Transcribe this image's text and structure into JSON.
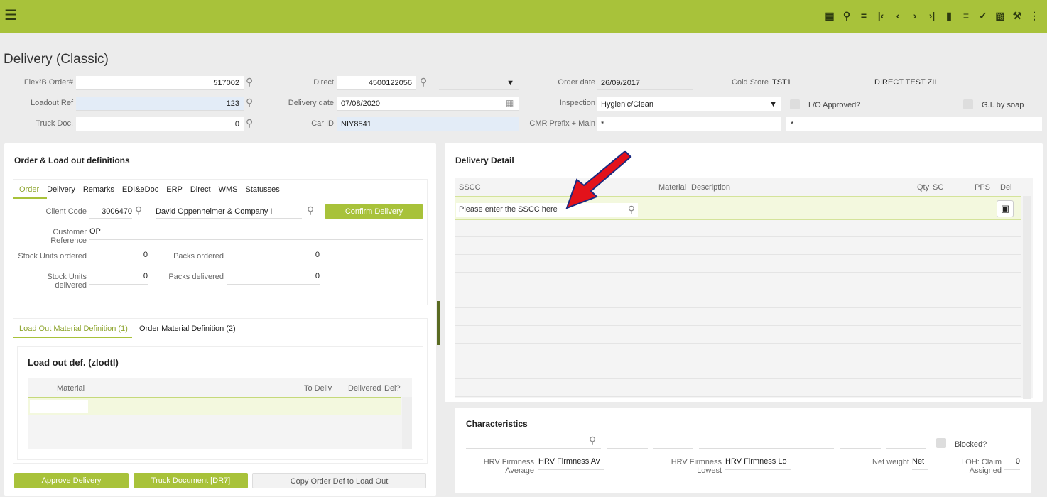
{
  "toolbar": {
    "menu_icon": "hamburger-icon",
    "icons": [
      "calendar-icon",
      "search-icon",
      "equals-icon",
      "first-icon",
      "prev-icon",
      "next-icon",
      "last-icon",
      "document-icon",
      "list-icon",
      "check-icon",
      "trash-icon",
      "wrench-icon",
      "more-icon"
    ]
  },
  "title": "Delivery (Classic)",
  "header": {
    "flex_order_label": "Flex²B Order#",
    "flex_order_value": "517002",
    "loadout_ref_label": "Loadout Ref",
    "loadout_ref_value": "123",
    "truck_doc_label": "Truck Doc.",
    "truck_doc_value": "0",
    "direct_label": "Direct",
    "direct_value": "4500122056",
    "delivery_date_label": "Delivery date",
    "delivery_date_value": "07/08/2020",
    "car_id_label": "Car ID",
    "car_id_value": "NIY8541",
    "order_date_label": "Order date",
    "order_date_value": "26/09/2017",
    "inspection_label": "Inspection",
    "inspection_value": "Hygienic/Clean",
    "cmr_label": "CMR Prefix + Main",
    "cmr_value": "*",
    "cmr_main_value": "*",
    "cold_store_label": "Cold Store",
    "cold_store_value": "TST1",
    "direct_test": "DIRECT TEST ZIL",
    "lo_approved_label": "L/O Approved?",
    "gi_soap_label": "G.I. by soap"
  },
  "order_panel": {
    "title": "Order & Load out definitions",
    "tabs": [
      "Order",
      "Delivery",
      "Remarks",
      "EDI&eDoc",
      "ERP",
      "Direct",
      "WMS",
      "Statusses"
    ],
    "client_code_label": "Client Code",
    "client_code_value": "3006470",
    "client_name": "David Oppenheimer & Company I",
    "confirm_label": "Confirm Delivery",
    "customer_ref_label_1": "Customer",
    "customer_ref_label_2": "Reference",
    "customer_ref_value": "OP",
    "stock_ordered_label": "Stock Units ordered",
    "stock_ordered_value": "0",
    "packs_ordered_label": "Packs ordered",
    "packs_ordered_value": "0",
    "stock_delivered_label_1": "Stock Units",
    "stock_delivered_label_2": "delivered",
    "stock_delivered_value": "0",
    "packs_delivered_label": "Packs delivered",
    "packs_delivered_value": "0"
  },
  "loadout_panel": {
    "tabs": [
      "Load Out Material Definition (1)",
      "Order Material Definition (2)"
    ],
    "title": "Load out def. (zlodtl)",
    "columns": [
      "Material",
      "To Deliv",
      "Delivered",
      "Del?"
    ]
  },
  "buttons": {
    "approve": "Approve Delivery",
    "truck": "Truck Document [DR7]",
    "copy": "Copy Order Def to Load Out"
  },
  "delivery_detail": {
    "title": "Delivery Detail",
    "columns": [
      "SSCC",
      "Material",
      "Description",
      "Qty",
      "SC",
      "PPS",
      "Del"
    ],
    "sscc_placeholder": "Please enter the SSCC here"
  },
  "characteristics": {
    "title": "Characteristics",
    "blocked_label": "Blocked?",
    "hrv_avg_label_1": "HRV Firmness",
    "hrv_avg_label_2": "Average",
    "hrv_avg_value": "HRV Firmness Av",
    "hrv_low_label_1": "HRV Firmness",
    "hrv_low_label_2": "Lowest",
    "hrv_low_value": "HRV Firmness Lo",
    "net_weight_label": "Net weight",
    "net_weight_value": "Net",
    "loh_label_1": "LOH: Claim",
    "loh_label_2": "Assigned",
    "loh_value": "0"
  },
  "colors": {
    "accent": "#a8c23a",
    "arrow": "#e3121b"
  }
}
